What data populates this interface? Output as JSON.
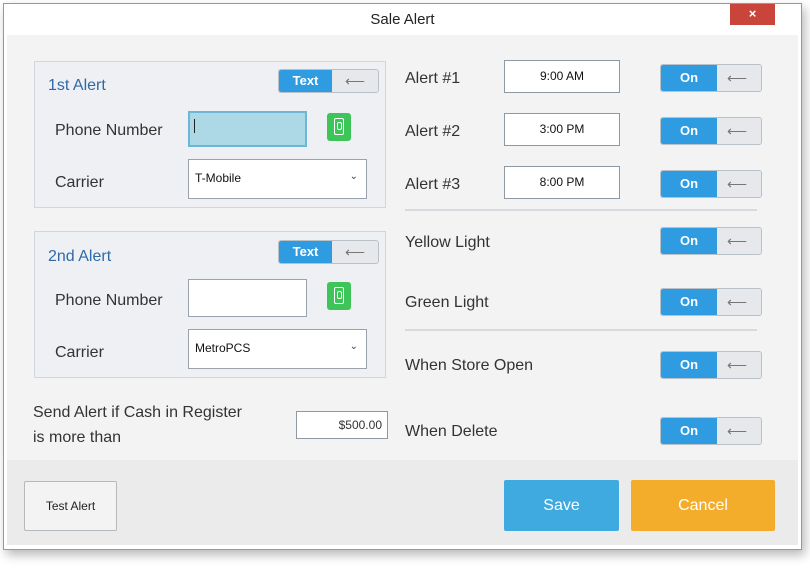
{
  "window": {
    "title": "Sale Alert",
    "close_glyph": "×"
  },
  "first_alert": {
    "title": "1st Alert",
    "toggle_label": "Text",
    "phone_label": "Phone Number",
    "phone_value": "",
    "carrier_label": "Carrier",
    "carrier_value": "T-Mobile"
  },
  "second_alert": {
    "title": "2nd Alert",
    "toggle_label": "Text",
    "phone_label": "Phone Number",
    "phone_value": "",
    "carrier_label": "Carrier",
    "carrier_value": "MetroPCS"
  },
  "cash": {
    "label_line1": "Send Alert if Cash in Register",
    "label_line2": "is more than",
    "value": "$500.00"
  },
  "alerts": [
    {
      "label": "Alert #1",
      "time": "9:00 AM",
      "toggle": "On"
    },
    {
      "label": "Alert #2",
      "time": "3:00 PM",
      "toggle": "On"
    },
    {
      "label": "Alert #3",
      "time": "8:00 PM",
      "toggle": "On"
    }
  ],
  "lights": [
    {
      "label": "Yellow Light",
      "toggle": "On"
    },
    {
      "label": "Green Light",
      "toggle": "On"
    }
  ],
  "events": [
    {
      "label": "When Store Open",
      "toggle": "On"
    },
    {
      "label": "When Delete",
      "toggle": "On"
    }
  ],
  "footer": {
    "test_label": "Test Alert",
    "save_label": "Save",
    "cancel_label": "Cancel"
  },
  "icons": {
    "toggle_arrow": "left-arrow-icon",
    "phone": "mobile-phone-icon",
    "dropdown": "chevron-down-icon"
  },
  "colors": {
    "toggle_on": "#2f9be0",
    "phone_button": "#3ec55a",
    "save": "#3faae0",
    "cancel": "#f4ad2a",
    "close": "#c9453c",
    "panel_title": "#2f6aa8"
  }
}
